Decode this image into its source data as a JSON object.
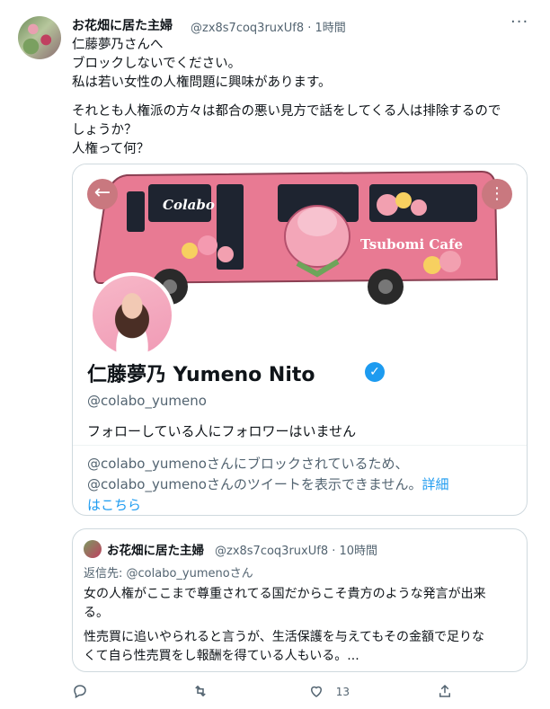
{
  "tweet": {
    "author_name": "お花畑に居た主婦",
    "handle_time": "@zx8s7coq3ruxUf8 · 1時間",
    "more": "···",
    "lines": [
      "仁藤夢乃さんへ",
      "ブロックしないでください。",
      "私は若い女性の人権問題に興味があります。",
      "それとも人権派の方々は都合の悪い見方で話をしてくる人は排除するので",
      "しょうか？",
      "人権って何？"
    ]
  },
  "profile_card": {
    "back_icon": "←",
    "more_icon": "⋮",
    "banner_bus_logo": "Colabo",
    "banner_bus_text": "Tsubomi Cafe",
    "display_name": "仁藤夢乃  Yumeno Nito",
    "verified": "✓",
    "handle": "@colabo_yumeno",
    "follow_note": "フォローしている人にフォロワーはいません",
    "blocked_line1": "@colabo_yumenoさんにブロックされているため、",
    "blocked_line2": "@colabo_yumenoさんのツイートを表示できません。",
    "blocked_link_a": "詳細",
    "blocked_link_b": "はこちら"
  },
  "quote": {
    "author_name": "お花畑に居た主婦",
    "handle_time": "@zx8s7coq3ruxUf8 · 10時間",
    "reply_to": "返信先: @colabo_yumenoさん",
    "lines": [
      "女の人権がここまで尊重されてる国だからこそ貴方のような発言が出来",
      "る。",
      "性売買に追いやられると言うが、生活保護を与えてもその金額で足りな",
      "くて自ら性売買をし報酬を得ている人もいる。..."
    ]
  },
  "actions": {
    "reply_icon": "reply-icon",
    "retweet_icon": "retweet-icon",
    "like_icon": "like-icon",
    "share_icon": "share-icon",
    "like_count": "13"
  },
  "colors": {
    "accent": "#1d9bf0",
    "bus_pink": "#e87a93",
    "text_secondary": "#536471"
  }
}
